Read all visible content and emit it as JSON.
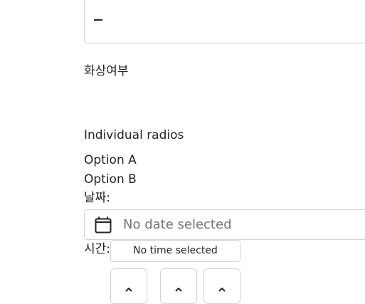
{
  "textarea": {
    "value": ""
  },
  "fields": {
    "burn_label": "화상여부",
    "radios_label": "Individual radios",
    "radio_options": [
      "Option A",
      "Option B"
    ],
    "date_label": "날짜:",
    "date_placeholder": "No date selected",
    "time_label": "시간:",
    "time_placeholder": "No time selected"
  },
  "icons": {
    "calendar": "calendar-icon",
    "spin_up": "chevron-up-icon"
  }
}
